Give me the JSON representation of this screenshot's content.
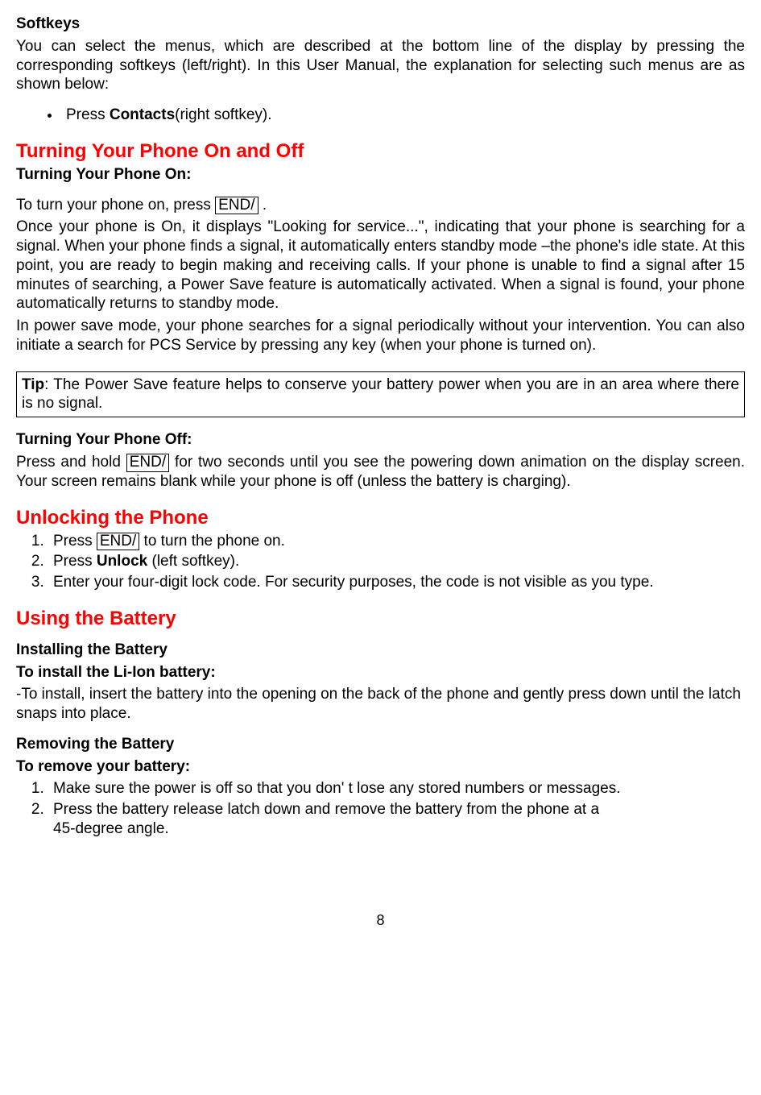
{
  "softkeys": {
    "heading": "Softkeys",
    "para": "You can select the menus, which are described at the bottom line of the display by pressing the corresponding softkeys (left/right). In this User Manual, the explanation for selecting such menus are as shown below:",
    "bullet_pre": "Press ",
    "bullet_bold": "Contacts",
    "bullet_post": "(right softkey)."
  },
  "turning": {
    "heading": "Turning Your Phone On and Off",
    "on_heading": "Turning Your Phone On:",
    "on_pre": "To turn your phone on, press ",
    "key_end": "END/",
    "on_post": " .",
    "on_para2": "Once your phone is On, it displays \"Looking for service...\", indicating that your phone is searching for a signal. When your phone finds a signal, it automatically enters standby mode –the phone's idle state. At this point, you are ready to begin making and receiving calls. If your phone is unable to find a signal after 15 minutes of searching, a Power Save feature is automatically activated. When a signal is found, your phone automatically returns to standby mode.",
    "on_para3": "In power save mode, your phone searches for a signal periodically without your intervention. You can also initiate a search for PCS Service by pressing any key (when your phone is turned on).",
    "tip_label": "Tip",
    "tip_body": ": The Power Save feature helps to conserve your battery power when you are in an area where there is no signal.",
    "off_heading": "Turning Your Phone Off:",
    "off_pre": "Press and hold ",
    "off_post": " for two seconds until you see the powering down animation on the display screen. Your screen remains blank while your phone is off (unless the battery is charging)."
  },
  "unlock": {
    "heading": "Unlocking the Phone",
    "step1_pre": "Press ",
    "step1_post": " to turn the phone on.",
    "step2_pre": "Press ",
    "step2_bold": "Unlock",
    "step2_post": " (left softkey).",
    "step3": "Enter your four-digit lock code. For security purposes, the code is not visible as you type."
  },
  "battery": {
    "heading": "Using the Battery",
    "install_h1": "Installing the Battery",
    "install_h2": "To install the Li-Ion battery:",
    "install_body": "-To install, insert the battery into the opening on the back of the phone and gently press down until the latch snaps into place.",
    "remove_h1": "Removing the Battery",
    "remove_h2": "To remove your battery:",
    "remove_step1": "Make sure the power is off so that you don' t lose any stored numbers or messages.",
    "remove_step2a": "Press the battery release latch down and remove the battery from the phone at a",
    "remove_step2b": "45-degree angle."
  },
  "page_number": "8",
  "key_end": "END/"
}
